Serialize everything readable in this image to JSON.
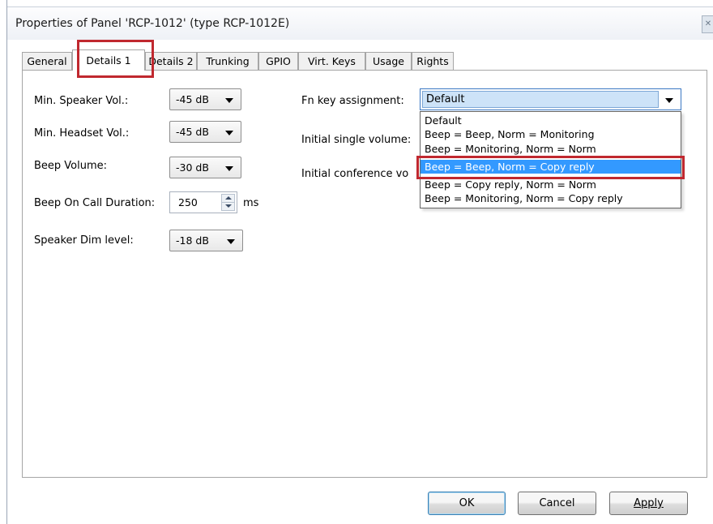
{
  "window": {
    "title": "Properties of Panel 'RCP-1012' (type RCP-1012E)"
  },
  "tabs": [
    {
      "label": "General"
    },
    {
      "label": "Details 1"
    },
    {
      "label": "Details 2"
    },
    {
      "label": "Trunking"
    },
    {
      "label": "GPIO"
    },
    {
      "label": "Virt. Keys"
    },
    {
      "label": "Usage"
    },
    {
      "label": "Rights"
    }
  ],
  "active_tab": "Details 1",
  "left_fields": {
    "min_speaker_vol": {
      "label": "Min. Speaker Vol.:",
      "value": "-45 dB"
    },
    "min_headset_vol": {
      "label": "Min. Headset Vol.:",
      "value": "-45 dB"
    },
    "beep_volume": {
      "label": "Beep Volume:",
      "value": "-30 dB"
    },
    "beep_on_call_duration": {
      "label": "Beep On Call Duration:",
      "value": "250",
      "unit": "ms"
    },
    "speaker_dim_level": {
      "label": "Speaker Dim level:",
      "value": "-18 dB"
    }
  },
  "right_fields": {
    "fn_key_assignment": {
      "label": "Fn key assignment:",
      "value": "Default"
    },
    "initial_single_volume": {
      "label": "Initial single volume:"
    },
    "initial_conference_volume": {
      "label": "Initial conference vo"
    }
  },
  "dropdown": {
    "options": [
      "Default",
      "Beep = Beep, Norm = Monitoring",
      "Beep = Monitoring, Norm = Norm",
      "Beep = Beep, Norm = Copy reply",
      "Beep = Copy reply, Norm = Norm",
      "Beep = Monitoring, Norm = Copy reply"
    ],
    "highlighted_option": "Beep = Beep, Norm = Copy reply"
  },
  "buttons": {
    "ok": "OK",
    "cancel": "Cancel",
    "apply": "Apply"
  },
  "colors": {
    "annotation_red": "#c0282f",
    "selection_blue": "#3399ff"
  }
}
